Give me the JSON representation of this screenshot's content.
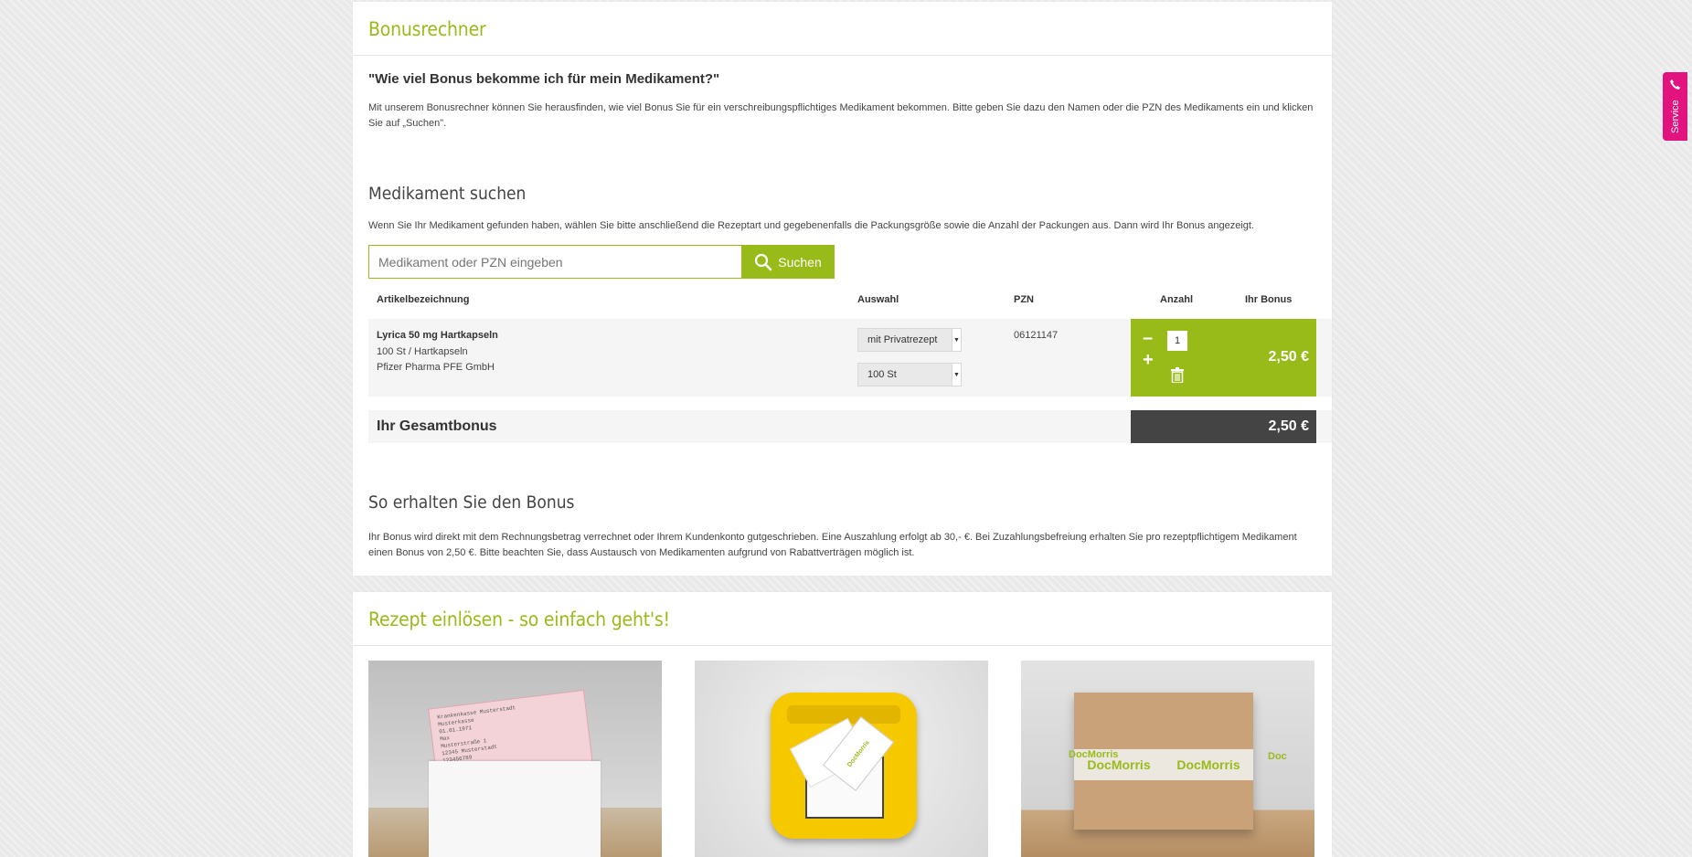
{
  "bonus": {
    "title": "Bonusrechner",
    "question": "\"Wie viel Bonus bekomme ich für mein Medikament?\"",
    "intro": "Mit unserem Bonusrechner können Sie herausfinden, wie viel Bonus Sie für ein verschreibungspflichtiges Medikament bekommen. Bitte geben Sie dazu den Namen oder die PZN des Medikaments ein und klicken Sie auf „Suchen\".",
    "search_heading": "Medikament suchen",
    "search_help": "Wenn Sie Ihr Medikament gefunden haben, wählen Sie bitte anschließend die Rezeptart und gegebenenfalls die Packungsgröße sowie die Anzahl der Packungen aus. Dann wird Ihr Bonus angezeigt.",
    "search_placeholder": "Medikament oder PZN eingeben",
    "search_button": "Suchen"
  },
  "table": {
    "headers": {
      "article": "Artikelbezeichnung",
      "selection": "Auswahl",
      "pzn": "PZN",
      "quantity": "Anzahl",
      "bonus": "Ihr Bonus"
    },
    "rows": [
      {
        "name": "Lyrica 50 mg Hartkapseln",
        "package": "100 St / Hartkapseln",
        "manufacturer": "Pfizer Pharma PFE GmbH",
        "prescription_type": "mit Privatrezept",
        "package_size": "100 St",
        "pzn": "06121147",
        "quantity": "1",
        "minus": "–",
        "plus": "+",
        "bonus": "2,50 €"
      }
    ],
    "total_label": "Ihr Gesamtbonus",
    "total_value": "2,50 €"
  },
  "info": {
    "heading": "So erhalten Sie den Bonus",
    "text": "Ihr Bonus wird direkt mit dem Rechnungsbetrag verrechnet oder Ihrem Kundenkonto gutgeschrieben. Eine Auszahlung erfolgt ab 30,- €. Bei Zuzahlungsbefreiung erhalten Sie pro rezeptpflichtigem Medikament einen Bonus von 2,50 €. Bitte beachten Sie, dass Austausch von Medikamenten aufgrund von Rabattverträgen möglich ist."
  },
  "prescription": {
    "title": "Rezept einlösen - so einfach geht's!",
    "images": [
      {
        "label_lines": [
          "Krankenkasse Musterstadt",
          "Musterkasse",
          "01.01.1971",
          "Max",
          "Musterstraße 1",
          "12345 Musterstadt",
          "123456789",
          "456789101",
          "11",
          "12345789",
          "654987"
        ]
      },
      {
        "label_lines": [
          "DocMorris"
        ]
      },
      {
        "label_lines": [
          "DocMorris",
          "DocMorris",
          "Doc",
          "DocMorris"
        ]
      }
    ]
  },
  "service_tab": {
    "label": "Service"
  },
  "colors": {
    "brand_green": "#99bb1a",
    "dark": "#444444",
    "service_pink": "#e2127f"
  }
}
